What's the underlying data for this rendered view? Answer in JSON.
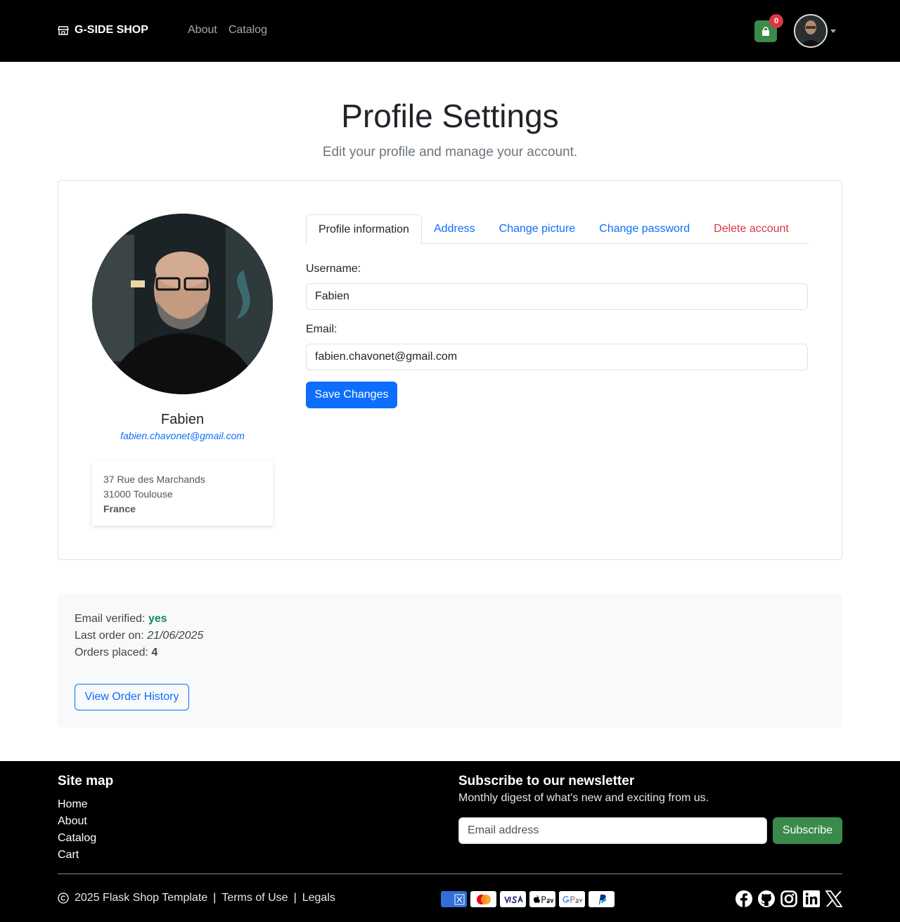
{
  "nav": {
    "brand": "G-SIDE SHOP",
    "links": [
      "About",
      "Catalog"
    ],
    "cart_count": "0"
  },
  "header": {
    "title": "Profile Settings",
    "subtitle": "Edit your profile and manage your account."
  },
  "profile": {
    "name": "Fabien",
    "email": "fabien.chavonet@gmail.com",
    "address": {
      "line1": "37 Rue des Marchands",
      "line2": "31000 Toulouse",
      "country": "France"
    }
  },
  "tabs": [
    "Profile information",
    "Address",
    "Change picture",
    "Change password",
    "Delete account"
  ],
  "form": {
    "username_label": "Username:",
    "username_value": "Fabien",
    "email_label": "Email:",
    "email_value": "fabien.chavonet@gmail.com",
    "save_label": "Save Changes"
  },
  "stats": {
    "email_verified_label": "Email verified:",
    "email_verified_value": "yes",
    "last_order_label": "Last order on:",
    "last_order_value": "21/06/2025",
    "orders_placed_label": "Orders placed:",
    "orders_placed_value": "4",
    "history_button": "View Order History"
  },
  "footer": {
    "sitemap_title": "Site map",
    "sitemap_links": [
      "Home",
      "About",
      "Catalog",
      "Cart"
    ],
    "newsletter_title": "Subscribe to our newsletter",
    "newsletter_desc": "Monthly digest of what's new and exciting from us.",
    "newsletter_placeholder": "Email address",
    "subscribe_label": "Subscribe",
    "copyright": "2025 Flask Shop Template",
    "terms": "Terms of Use",
    "legals": "Legals",
    "payment_icons": [
      "amex-icon",
      "mastercard-icon",
      "visa-icon",
      "apple-pay-icon",
      "google-pay-icon",
      "paypal-icon"
    ],
    "social_icons": [
      "facebook-icon",
      "github-icon",
      "instagram-icon",
      "linkedin-icon",
      "x-icon"
    ]
  },
  "colors": {
    "primary": "#0d6efd",
    "success": "#3a8a4c",
    "danger": "#dc3545",
    "navbar": "#000000"
  }
}
